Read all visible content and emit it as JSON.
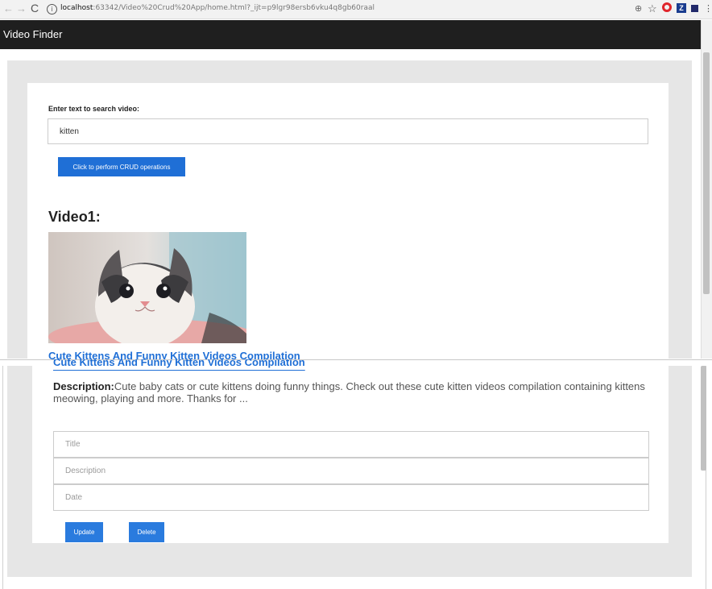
{
  "browser": {
    "url_host": "localhost",
    "url_rest": ":63342/Video%20Crud%20App/home.html?_ijt=p9lgr98ersb6vku4q8gb60raal",
    "info_glyph": "i",
    "ext_icons": [
      "zoom-icon",
      "star-icon",
      "opera-icon",
      "zotero-icon",
      "extension-icon",
      "menu-icon"
    ]
  },
  "app": {
    "title": "Video Finder"
  },
  "search": {
    "label": "Enter text to search video:",
    "value": "kitten"
  },
  "crud_button": "Click to perform CRUD operations",
  "video": {
    "heading": "Video1:",
    "title": "Cute Kittens And Funny Kitten Videos Compilation",
    "title_cut": "Cute Kittens And Funny Kitten Videos Compilation",
    "description_label": "Description:",
    "description": "Cute baby cats or cute kittens doing funny things. Check out these cute kitten videos compilation containing kittens meowing, playing and more. Thanks for ..."
  },
  "form": {
    "title_placeholder": "Title",
    "description_placeholder": "Description",
    "date_placeholder": "Date",
    "update_label": "Update",
    "delete_label": "Delete"
  },
  "colors": {
    "appbar": "#1f1f1f",
    "accent": "#1f6fd6",
    "panel": "#e6e6e6"
  }
}
